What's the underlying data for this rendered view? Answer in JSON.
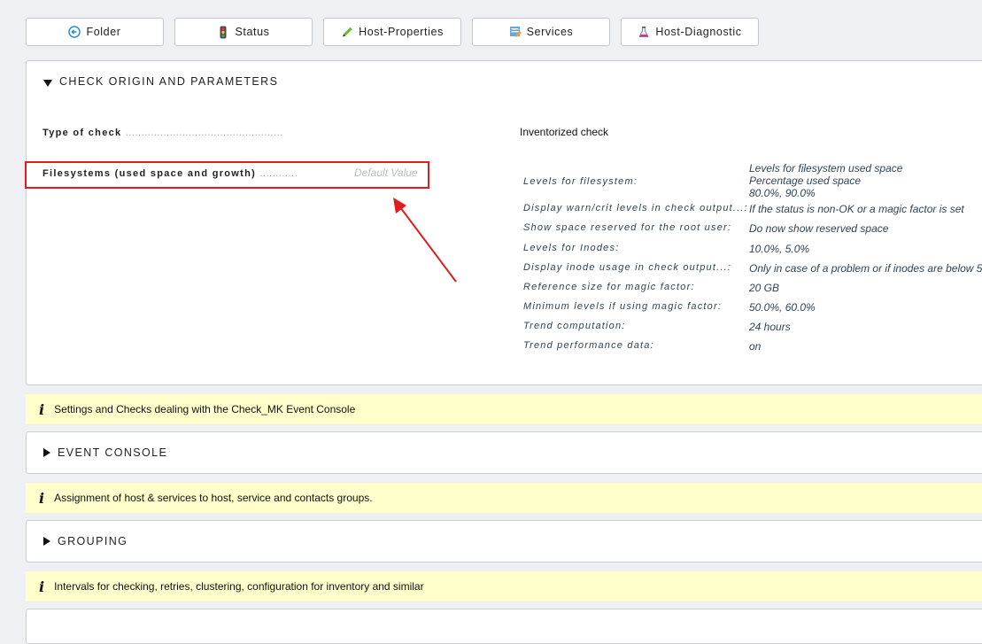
{
  "toolbar": [
    {
      "label": "Folder",
      "icon": "folder-back-icon"
    },
    {
      "label": "Status",
      "icon": "traffic-light-icon"
    },
    {
      "label": "Host-Properties",
      "icon": "pencil-icon"
    },
    {
      "label": "Services",
      "icon": "services-icon"
    },
    {
      "label": "Host-Diagnostic",
      "icon": "flask-icon"
    }
  ],
  "check_section": {
    "title": "CHECK ORIGIN AND PARAMETERS",
    "type_of_check_label": "Type of check",
    "type_of_check_dots": "..................................................",
    "type_of_check_value": "Inventorized check",
    "fs_label": "Filesystems (used space and growth)",
    "fs_dots": "............",
    "fs_default": "Default Value",
    "params": [
      {
        "key": "Levels for filesystem:",
        "value": [
          "Levels for filesystem used space",
          "Percentage used space",
          "80.0%, 90.0%"
        ]
      },
      {
        "key": "Display warn/crit levels in check output...:",
        "value": [
          "If the status is non-OK or a magic factor is set"
        ]
      },
      {
        "key": "Show space reserved for the root user:",
        "value": [
          "Do now show reserved space"
        ]
      },
      {
        "key": "Levels for Inodes:",
        "value": [
          "10.0%, 5.0%"
        ]
      },
      {
        "key": "Display inode usage in check output...:",
        "value": [
          "Only in case of a problem or if inodes are below 5"
        ]
      },
      {
        "key": "Reference size for magic factor:",
        "value": [
          "20 GB"
        ]
      },
      {
        "key": "Minimum levels if using magic factor:",
        "value": [
          "50.0%, 60.0%"
        ]
      },
      {
        "key": "Trend computation:",
        "value": [
          "24 hours"
        ]
      },
      {
        "key": "Trend performance data:",
        "value": [
          "on"
        ]
      }
    ]
  },
  "info1": {
    "icon": "i",
    "text": "Settings and Checks dealing with the Check_MK Event Console"
  },
  "event_console": {
    "title": "EVENT CONSOLE"
  },
  "info2": {
    "icon": "i",
    "text": "Assignment of host & services to host, service and contacts groups."
  },
  "grouping": {
    "title": "GROUPING"
  },
  "info3": {
    "icon": "i",
    "text": "Intervals for checking, retries, clustering, configuration for inventory and similar"
  },
  "colors": {
    "highlight": "#e21b1b",
    "info_bg": "#ffffcc",
    "page_bg": "#eff0f4"
  }
}
